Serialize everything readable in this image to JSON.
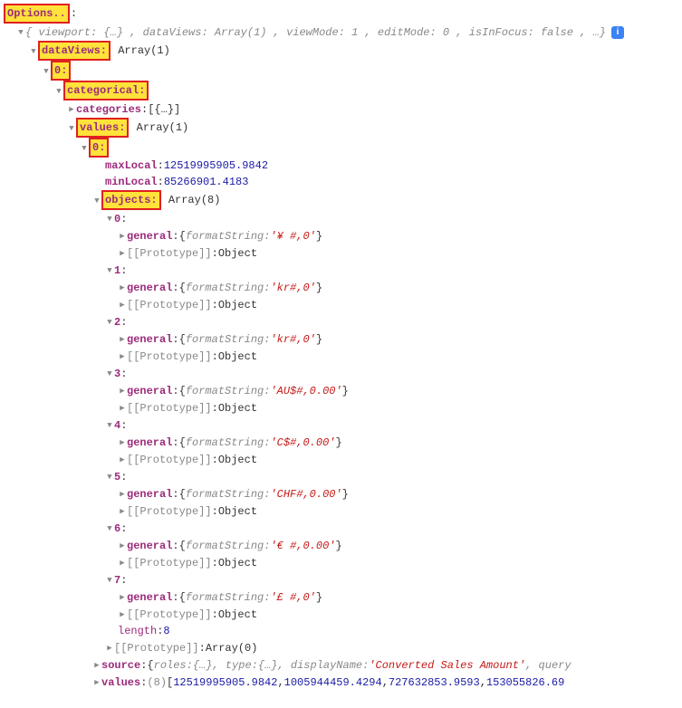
{
  "options_label": "Options..",
  "root_summary": {
    "viewport_key": "viewport: ",
    "viewport_val": "{…}",
    "dataViews_key": ", dataViews: ",
    "dataViews_val": "Array(1)",
    "viewMode_key": ", viewMode: ",
    "viewMode_val": "1",
    "editMode_key": ", editMode: ",
    "editMode_val": "0",
    "isInFocus_key": ", isInFocus: ",
    "isInFocus_val": "false",
    "tail": ", …}"
  },
  "info_badge": "i",
  "dataViews": {
    "label": "dataViews:",
    "type": "Array(1)",
    "idx0": "0:",
    "categorical": {
      "label": "categorical:",
      "categories_key": "categories",
      "categories_val": "[{…}]",
      "values": {
        "label": "values:",
        "type": "Array(1)",
        "idx0": "0:",
        "maxLocal_key": "maxLocal",
        "maxLocal_val": "12519995905.9842",
        "minLocal_key": "minLocal",
        "minLocal_val": "85266901.4183",
        "objects": {
          "label": "objects:",
          "type": "Array(8)",
          "items": [
            {
              "idx": "0",
              "general_key": "general",
              "fs_key": "formatString: ",
              "fs": "'¥ #,0'",
              "proto_key": "[[Prototype]]",
              "proto_val": "Object"
            },
            {
              "idx": "1",
              "general_key": "general",
              "fs_key": "formatString: ",
              "fs": "'kr#,0'",
              "proto_key": "[[Prototype]]",
              "proto_val": "Object"
            },
            {
              "idx": "2",
              "general_key": "general",
              "fs_key": "formatString: ",
              "fs": "'kr#,0'",
              "proto_key": "[[Prototype]]",
              "proto_val": "Object"
            },
            {
              "idx": "3",
              "general_key": "general",
              "fs_key": "formatString: ",
              "fs": "'AU$#,0.00'",
              "proto_key": "[[Prototype]]",
              "proto_val": "Object"
            },
            {
              "idx": "4",
              "general_key": "general",
              "fs_key": "formatString: ",
              "fs": "'C$#,0.00'",
              "proto_key": "[[Prototype]]",
              "proto_val": "Object"
            },
            {
              "idx": "5",
              "general_key": "general",
              "fs_key": "formatString: ",
              "fs": "'CHF#,0.00'",
              "proto_key": "[[Prototype]]",
              "proto_val": "Object"
            },
            {
              "idx": "6",
              "general_key": "general",
              "fs_key": "formatString: ",
              "fs": "'€ #,0.00'",
              "proto_key": "[[Prototype]]",
              "proto_val": "Object"
            },
            {
              "idx": "7",
              "general_key": "general",
              "fs_key": "formatString: ",
              "fs": "'£ #,0'",
              "proto_key": "[[Prototype]]",
              "proto_val": "Object"
            }
          ],
          "length_key": "length",
          "length_val": "8",
          "proto_key": "[[Prototype]]",
          "proto_val": "Array(0)"
        },
        "source": {
          "key": "source",
          "roles_key": "roles: ",
          "roles_val": "{…}",
          "type_key": ", type: ",
          "type_val": "{…}",
          "dn_key": ", displayName: ",
          "dn_val": "'Converted Sales Amount'",
          "tail": ", query"
        },
        "values_arr": {
          "key": "values",
          "count": "(8)",
          "v0": "12519995905.9842",
          "v1": "1005944459.4294",
          "v2": "727632853.9593",
          "v3": "153055826.69"
        }
      }
    }
  },
  "glyphs": {
    "open_brace": "{",
    "close_brace": "}",
    "open_bracket": "[",
    "comma": ", ",
    "colon": ": "
  }
}
